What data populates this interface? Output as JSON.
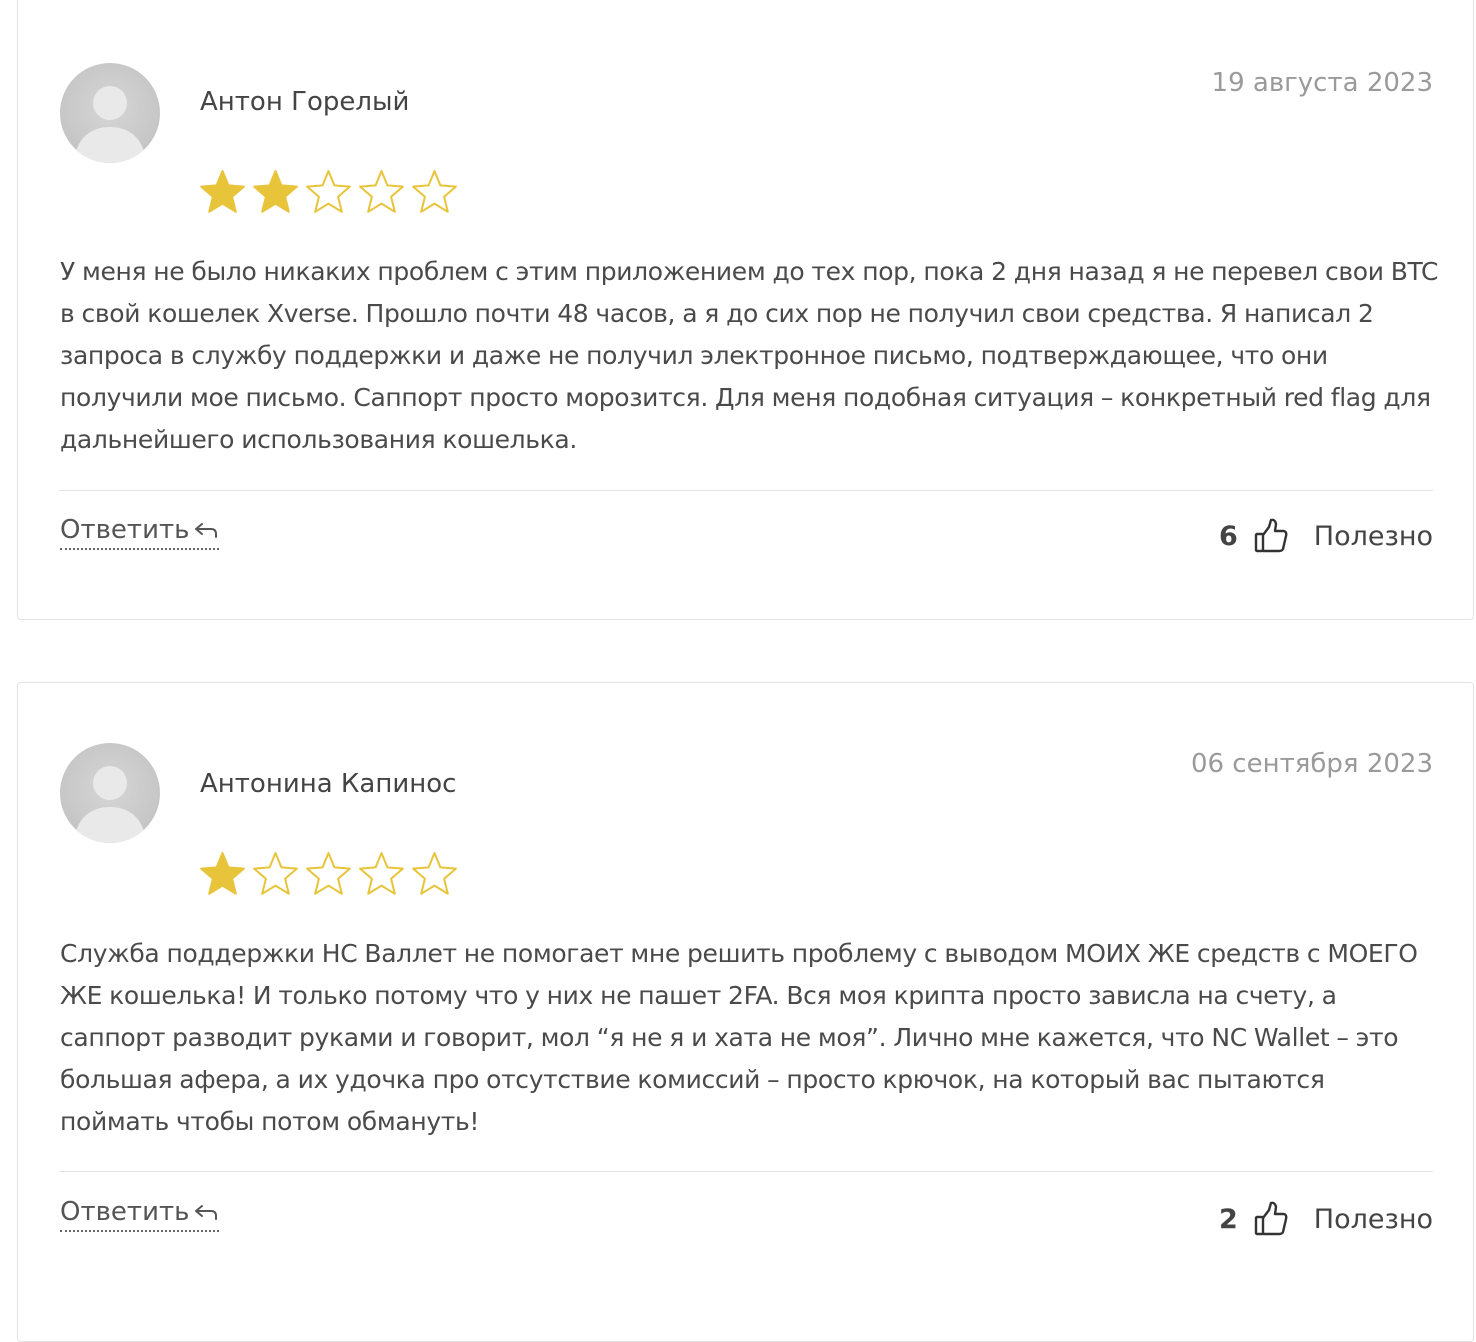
{
  "reviews": [
    {
      "author": "Антон Горелый",
      "date": "19 августа 2023",
      "rating": 2,
      "max_rating": 5,
      "text": "У меня не было никаких проблем с этим приложением до тех пор, пока 2 дня назад я не перевел свои BTC в свой кошелек Xverse. Прошло почти 48 часов, а я до сих пор не получил свои средства. Я написал 2 запроса в службу поддержки и даже не получил электронное письмо, подтверждающее, что они получили мое письмо. Саппорт просто морозится. Для меня подобная ситуация – конкретный red flag для дальнейшего использования кошелька.",
      "reply_label": "Ответить",
      "likes": "6",
      "helpful_label": "Полезно"
    },
    {
      "author": "Антонина Капинос",
      "date": "06 сентября 2023",
      "rating": 1,
      "max_rating": 5,
      "text": "Служба поддержки НС Валлет не помогает мне решить проблему с выводом МОИХ ЖЕ средств с МОЕГО ЖЕ кошелька! И только потому что у них не пашет 2FA. Вся моя крипта просто зависла на счету, а саппорт разводит руками и говорит, мол “я не я и хата не моя”. Лично мне кажется, что NC Wallet – это большая афера, а их удочка про отсутствие комиссий – просто крючок, на который вас пытаются поймать чтобы потом обмануть!",
      "reply_label": "Ответить",
      "likes": "2",
      "helpful_label": "Полезно"
    }
  ],
  "colors": {
    "star": "#e8c43a",
    "text": "#444444",
    "date": "#9a9a9a",
    "border": "#e3e3e3"
  },
  "icons": {
    "avatar": "user-silhouette-icon",
    "reply": "reply-arrow-icon",
    "like": "thumbs-up-icon",
    "star": "star-icon"
  }
}
